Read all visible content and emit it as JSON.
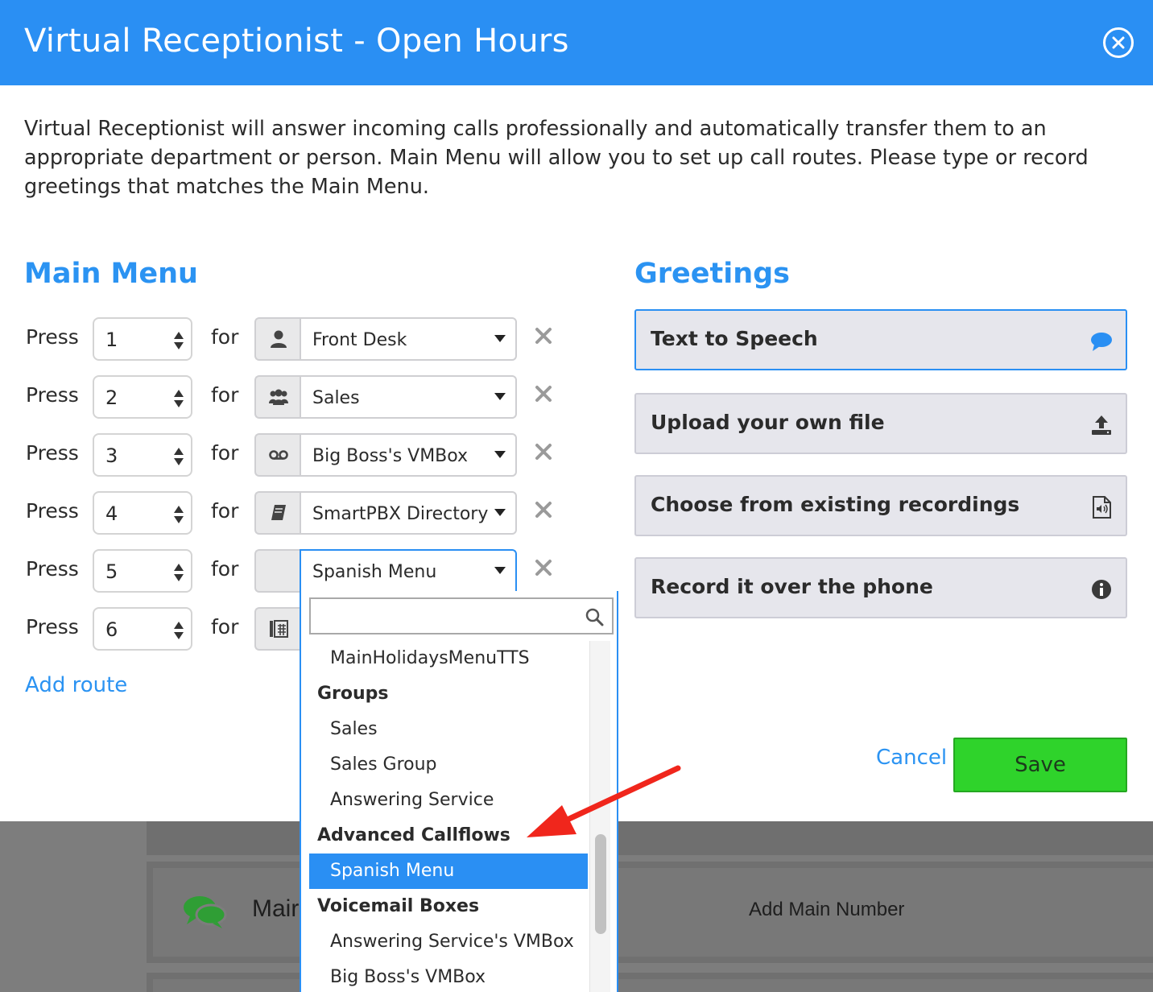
{
  "modal": {
    "title": "Virtual Receptionist - Open Hours",
    "intro": "Virtual Receptionist will answer incoming calls professionally and automatically transfer them to an appropriate department or person. Main Menu will allow you to set up call routes. Please type or record greetings that matches the Main Menu."
  },
  "main_menu": {
    "title": "Main Menu",
    "press_label": "Press",
    "for_label": "for",
    "routes": [
      {
        "key": "1",
        "icon": "user-icon",
        "target": "Front Desk"
      },
      {
        "key": "2",
        "icon": "group-icon",
        "target": "Sales"
      },
      {
        "key": "3",
        "icon": "voicemail-icon",
        "target": "Big Boss's VMBox"
      },
      {
        "key": "4",
        "icon": "directory-icon",
        "target": "SmartPBX Directory"
      },
      {
        "key": "5",
        "icon": "",
        "target": "Spanish Menu"
      },
      {
        "key": "6",
        "icon": "fax-icon",
        "target": ""
      }
    ],
    "add_route": "Add route"
  },
  "greetings": {
    "title": "Greetings",
    "options": [
      {
        "label": "Text to Speech",
        "icon": "speech-bubble-icon",
        "active": true
      },
      {
        "label": "Upload your own file",
        "icon": "upload-icon",
        "active": false
      },
      {
        "label": "Choose from existing recordings",
        "icon": "audio-file-icon",
        "active": false
      },
      {
        "label": "Record it over the phone",
        "icon": "info-icon",
        "active": false
      }
    ]
  },
  "actions": {
    "cancel": "Cancel",
    "save": "Save"
  },
  "dropdown": {
    "search_value": "",
    "items": [
      {
        "type": "item",
        "label": "MainHolidaysMenuTTS"
      },
      {
        "type": "group",
        "label": "Groups"
      },
      {
        "type": "item",
        "label": "Sales"
      },
      {
        "type": "item",
        "label": "Sales Group"
      },
      {
        "type": "item",
        "label": "Answering Service"
      },
      {
        "type": "group",
        "label": "Advanced Callflows"
      },
      {
        "type": "item",
        "label": "Spanish Menu",
        "selected": true
      },
      {
        "type": "group",
        "label": "Voicemail Boxes"
      },
      {
        "type": "item",
        "label": "Answering Service's VMBox"
      },
      {
        "type": "item",
        "label": "Big Boss's VMBox"
      }
    ]
  },
  "background": {
    "main_label": "Mair",
    "add_main_number": "Add Main Number"
  },
  "colors": {
    "accent": "#2a8ff3",
    "save": "#2fd32b",
    "arrow": "#f0261c"
  }
}
